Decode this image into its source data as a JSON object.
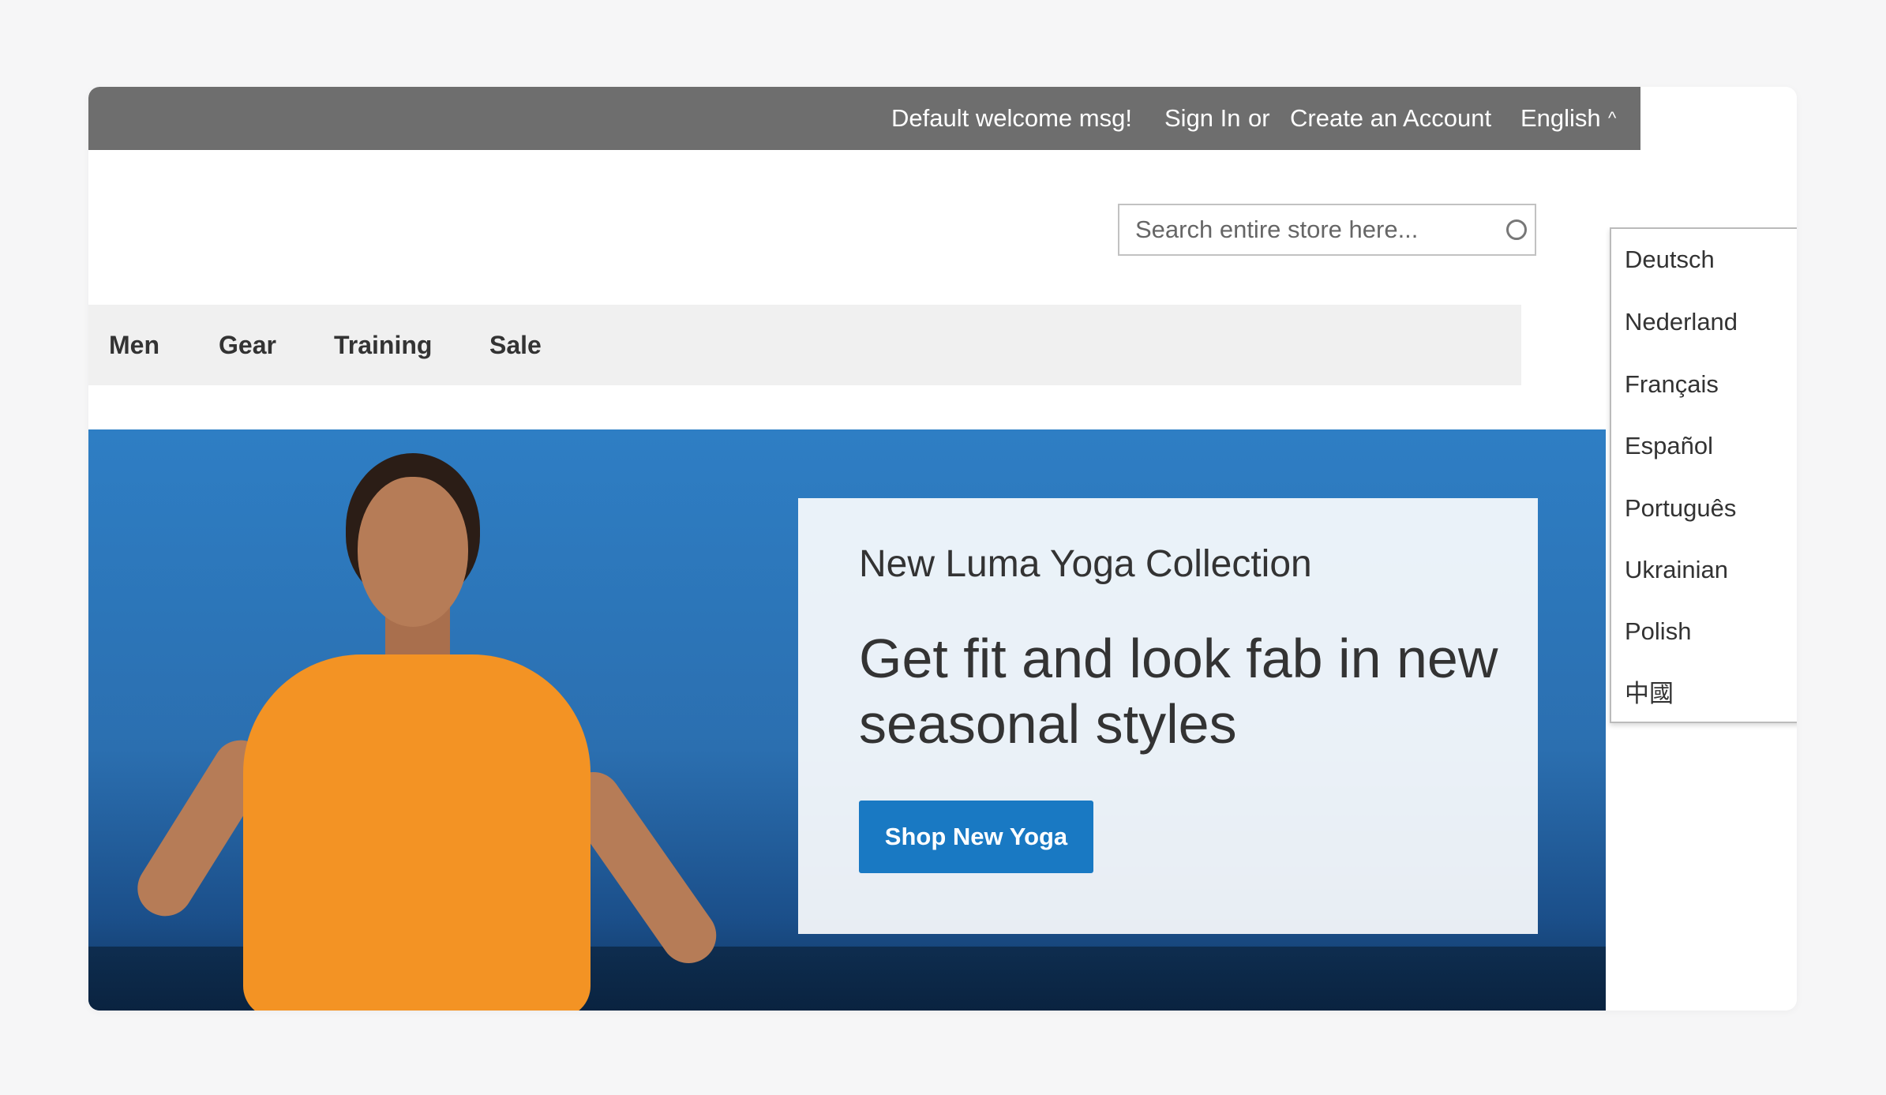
{
  "header": {
    "welcome": "Default welcome msg!",
    "sign_in": "Sign In",
    "or": "or",
    "create_account": "Create an Account",
    "language": "English",
    "caret": "^"
  },
  "search": {
    "placeholder": "Search entire store here..."
  },
  "nav": {
    "items": [
      "Men",
      "Gear",
      "Training",
      "Sale"
    ]
  },
  "hero": {
    "subtitle": "New Luma Yoga Collection",
    "title": "Get fit and look fab in new seasonal styles",
    "button": "Shop New Yoga"
  },
  "language_menu": {
    "options": [
      "Deutsch",
      "Nederland",
      "Français",
      "Español",
      "Português",
      "Ukrainian",
      "Polish",
      "中國"
    ]
  },
  "colors": {
    "topbar": "#6e6e6e",
    "button": "#1979c3",
    "hero_blue": "#2e7ec4",
    "shirt_orange": "#f39324"
  }
}
